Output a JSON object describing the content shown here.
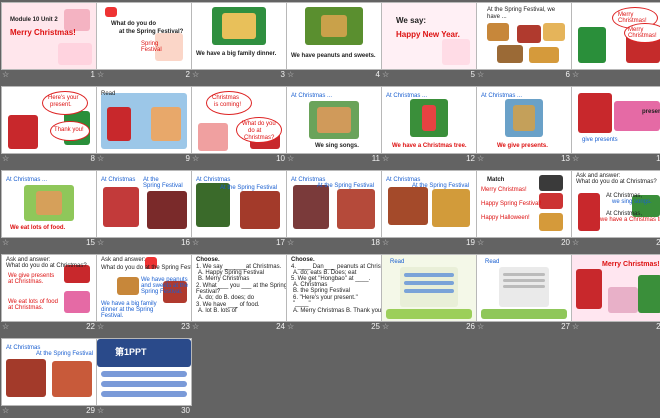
{
  "slides": [
    {
      "num": "1",
      "lines": [
        "Module 10 Unit 2",
        "Merry Christmas!"
      ]
    },
    {
      "num": "2",
      "lines": [
        "What do you do",
        "at the Spring Festival?",
        "Spring",
        "Festival"
      ]
    },
    {
      "num": "3",
      "lines": [
        "We have a big family dinner."
      ]
    },
    {
      "num": "4",
      "lines": [
        "We have peanuts and sweets."
      ]
    },
    {
      "num": "5",
      "lines": [
        "We say:",
        "Happy New Year."
      ]
    },
    {
      "num": "6",
      "lines": [
        "At the Spring Festival, we",
        "have ..."
      ]
    },
    {
      "num": "7",
      "lines": [
        "Merry",
        "Christmas!",
        "Merry",
        "Christmas!"
      ]
    },
    {
      "num": "8",
      "lines": [
        "Here's your",
        "present.",
        "Thank you!"
      ]
    },
    {
      "num": "9",
      "lines": [
        "Read"
      ]
    },
    {
      "num": "10",
      "lines": [
        "Christmas",
        "is coming!",
        "What do you",
        "do at",
        "Christmas?"
      ]
    },
    {
      "num": "11",
      "lines": [
        "At Christmas ...",
        "We sing songs."
      ]
    },
    {
      "num": "12",
      "lines": [
        "At Christmas ...",
        "We have a Christmas tree."
      ]
    },
    {
      "num": "13",
      "lines": [
        "At Christmas ...",
        "We give presents."
      ]
    },
    {
      "num": "14",
      "lines": [
        "present",
        "give presents"
      ]
    },
    {
      "num": "15",
      "lines": [
        "At Christmas ...",
        "We eat lots of food."
      ]
    },
    {
      "num": "16",
      "lines": [
        "At Christmas",
        "At the",
        "Spring Festival"
      ]
    },
    {
      "num": "17",
      "lines": [
        "At Christmas",
        "At the Spring Festival"
      ]
    },
    {
      "num": "18",
      "lines": [
        "At Christmas",
        "At the Spring Festival"
      ]
    },
    {
      "num": "19",
      "lines": [
        "At Christmas",
        "At the Spring Festival"
      ]
    },
    {
      "num": "20",
      "lines": [
        "Match",
        "Merry Christmas!",
        "Happy Spring Festival!",
        "Happy Halloween!"
      ]
    },
    {
      "num": "21",
      "lines": [
        "Ask and answer:",
        "What do you do at Christmas?",
        "At Christmas,",
        "we sing songs.",
        "At Christmas,",
        "we have a Christmas tree."
      ]
    },
    {
      "num": "22",
      "lines": [
        "Ask and answer:",
        "What do you do at Christmas?",
        "We give presents",
        "at Christmas.",
        "We eat lots of food",
        "at Christmas."
      ]
    },
    {
      "num": "23",
      "lines": [
        "Ask and answer:",
        "What do you do at the Spring Festival?",
        "We have peanuts",
        "and sweets at the",
        "Spring Festival.",
        "We have a big family",
        "dinner at the Spring",
        "Festival."
      ]
    },
    {
      "num": "24",
      "lines": [
        "Choose.",
        "1. We say ______ at Christmas.",
        "A. Happy Spring Festival",
        "B. Merry Christmas",
        "2. What ___ you ___ at the Spring",
        "Festival?",
        "A. do; do    B. does; do",
        "3. We have ___ of food.",
        "A. lot       B. lots of"
      ]
    },
    {
      "num": "25",
      "lines": [
        "Choose.",
        "4. ____ Dan ___ peanuts at Christmas.",
        "A. do; eats       B. Does; eat",
        "5. We get \"Hongbao\" at ____.",
        "A. Christmas",
        "B. the Spring Festival",
        "6. \"Here's your present.\"",
        "\"____\"",
        "A. Merry Christmas   B. Thank you."
      ]
    },
    {
      "num": "26",
      "lines": [
        "Read"
      ]
    },
    {
      "num": "27",
      "lines": [
        "Read"
      ]
    },
    {
      "num": "28",
      "lines": [
        "Merry Christmas!"
      ]
    },
    {
      "num": "29",
      "lines": [
        "At Christmas",
        "At the Spring Festival"
      ]
    },
    {
      "num": "30",
      "lines": [
        "第1PPT"
      ]
    }
  ],
  "star_icon": "☆",
  "colors": {
    "background": "#636363",
    "slide": "#ffffff",
    "accent_red": "#d11111",
    "accent_blue": "#1a5fd0"
  }
}
